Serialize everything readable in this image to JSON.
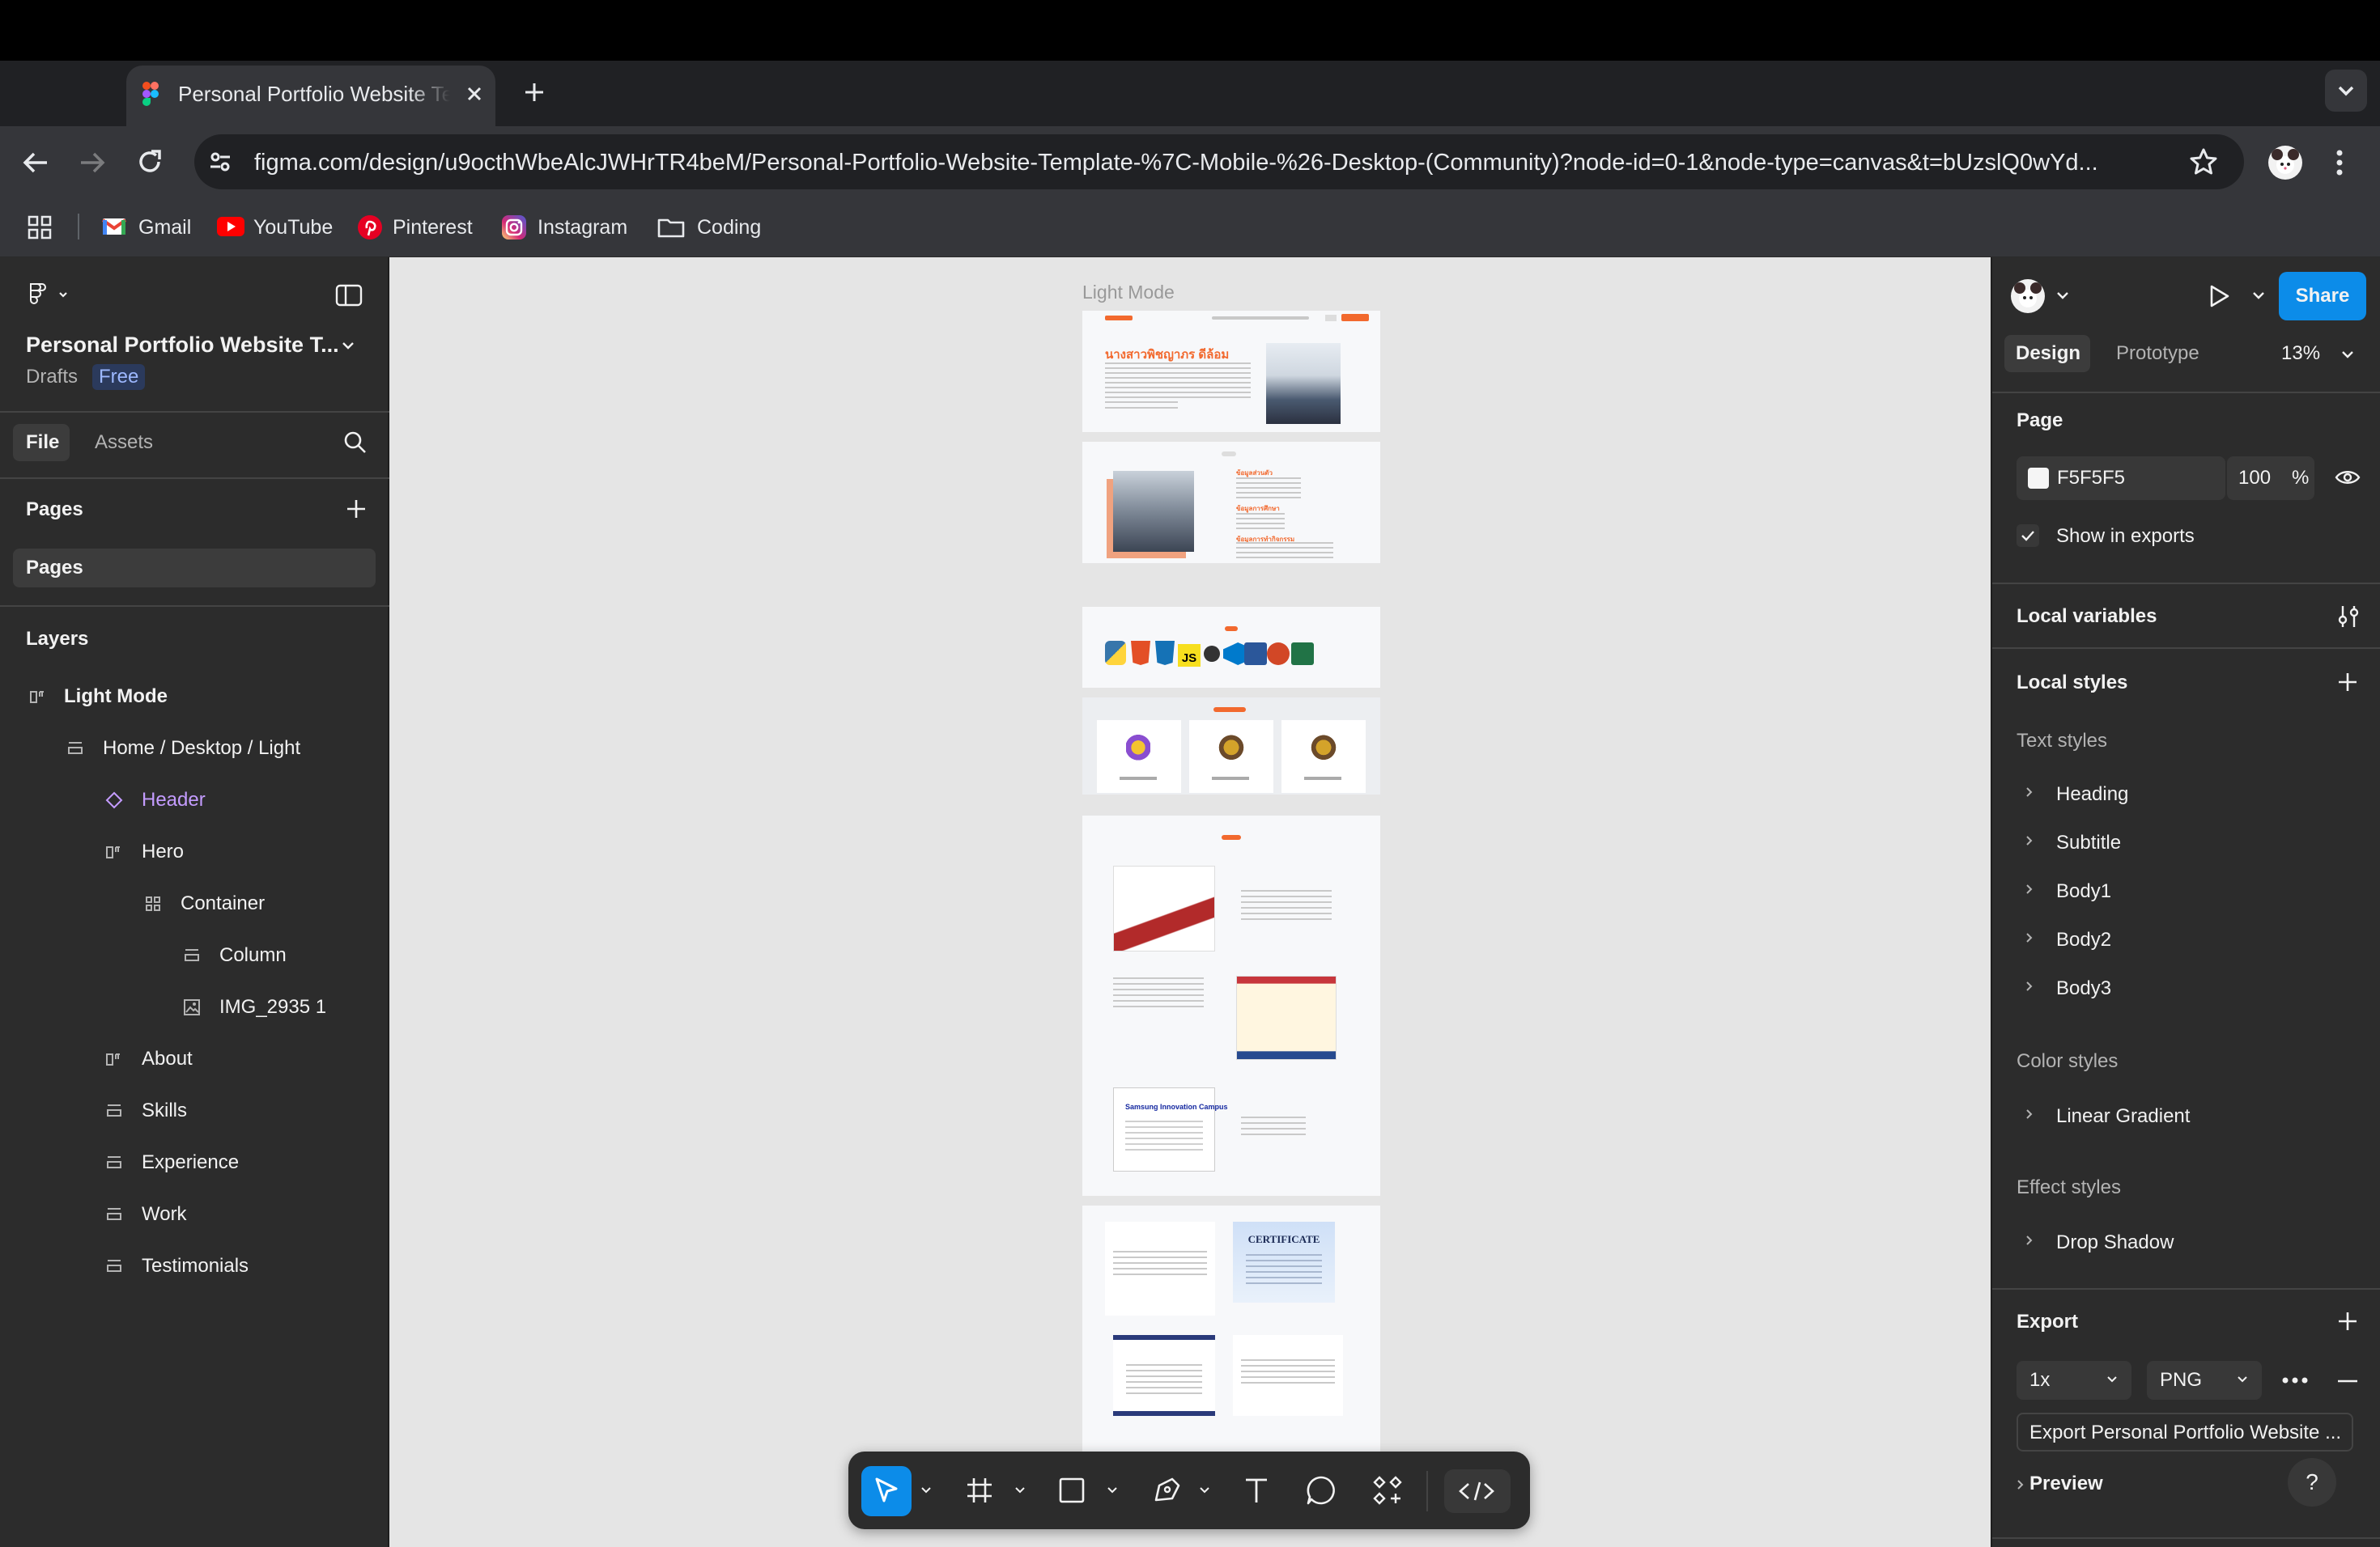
{
  "browser": {
    "tab_title": "Personal Portfolio Website Template | Mobile & Desktop (Community)",
    "url": "figma.com/design/u9octhWbeAlcJWHrTR4beM/Personal-Portfolio-Website-Template-%7C-Mobile-%26-Desktop-(Community)?node-id=0-1&node-type=canvas&t=bUzslQ0wYd...",
    "bookmarks": [
      "Gmail",
      "YouTube",
      "Pinterest",
      "Instagram",
      "Coding"
    ]
  },
  "left_panel": {
    "file_name": "Personal Portfolio Website T...",
    "location": "Drafts",
    "plan_badge": "Free",
    "tabs": [
      "File",
      "Assets"
    ],
    "pages_heading": "Pages",
    "pages": [
      "Pages"
    ],
    "layers_heading": "Layers",
    "layers": [
      {
        "name": "Light Mode",
        "icon": "frame-icon"
      },
      {
        "name": "Home / Desktop / Light",
        "icon": "autolayout-vertical-icon"
      },
      {
        "name": "Header",
        "icon": "component-instance-icon"
      },
      {
        "name": "Hero",
        "icon": "frame-icon"
      },
      {
        "name": "Container",
        "icon": "autolayout-grid-icon"
      },
      {
        "name": "Column",
        "icon": "autolayout-vertical-icon"
      },
      {
        "name": "IMG_2935 1",
        "icon": "image-icon"
      },
      {
        "name": "About",
        "icon": "frame-icon"
      },
      {
        "name": "Skills",
        "icon": "autolayout-vertical-icon"
      },
      {
        "name": "Experience",
        "icon": "autolayout-vertical-icon"
      },
      {
        "name": "Work",
        "icon": "autolayout-vertical-icon"
      },
      {
        "name": "Testimonials",
        "icon": "autolayout-vertical-icon"
      }
    ]
  },
  "canvas": {
    "frame_label": "Light Mode",
    "hero_name": "นางสาวพิชญาภร ดีล้อม",
    "about_heading": "ข้อมูลส่วนตัว",
    "about_heading2": "ข้อมูลการศึกษา",
    "about_heading3": "ข้อมูลการทำกิจกรรม",
    "skill_js": "JS",
    "certificate_title": "CERTIFICATE",
    "samsung_title": "Samsung Innovation Campus",
    "colors": {
      "accent": "#f2692e",
      "canvas_bg": "#e5e5e5"
    }
  },
  "right_panel": {
    "user_menu": "avatar",
    "share_label": "Share",
    "tabs": [
      "Design",
      "Prototype"
    ],
    "zoom": "13%",
    "page_heading": "Page",
    "page_color": "F5F5F5",
    "page_opacity": "100",
    "percent_sign": "%",
    "show_in_exports": "Show in exports",
    "local_variables": "Local variables",
    "local_styles": "Local styles",
    "text_styles_heading": "Text styles",
    "text_styles": [
      "Heading",
      "Subtitle",
      "Body1",
      "Body2",
      "Body3"
    ],
    "color_styles_heading": "Color styles",
    "color_styles": [
      "Linear Gradient"
    ],
    "effect_styles_heading": "Effect styles",
    "effect_styles": [
      "Drop Shadow"
    ],
    "export_heading": "Export",
    "export_scale": "1x",
    "export_format": "PNG",
    "export_button": "Export Personal Portfolio Website ...",
    "preview": "Preview",
    "help": "?"
  },
  "bottom_toolbar": {
    "tools": [
      "move-tool",
      "frame-tool",
      "shape-tool",
      "pen-tool",
      "text-tool",
      "comment-tool",
      "actions-tool",
      "dev-mode-toggle"
    ]
  }
}
